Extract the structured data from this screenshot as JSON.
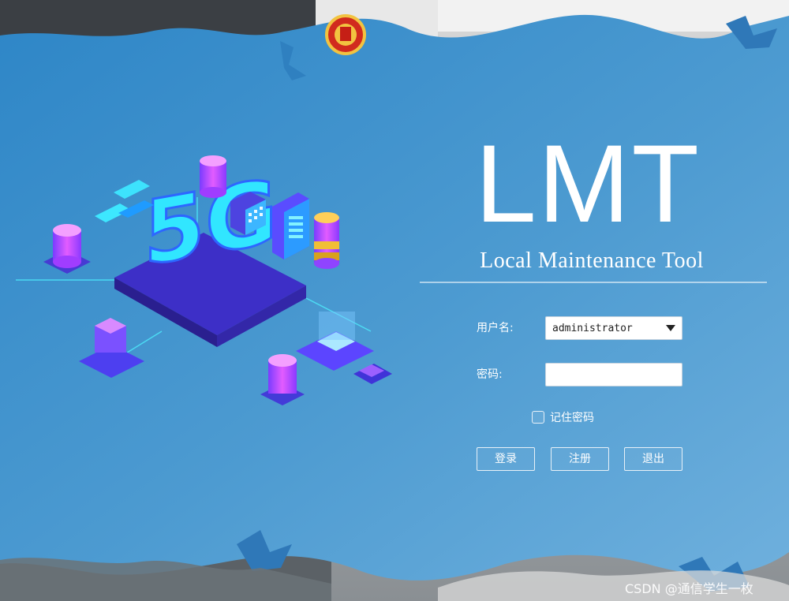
{
  "app": {
    "title": "LMT",
    "subtitle": "Local Maintenance Tool"
  },
  "illustration": {
    "text": "5G"
  },
  "form": {
    "username_label": "用户名:",
    "username_value": "administrator",
    "password_label": "密码:",
    "password_value": "",
    "remember_label": "记住密码",
    "remember_checked": false
  },
  "buttons": {
    "login": "登录",
    "register": "注册",
    "exit": "退出"
  },
  "watermark": "CSDN @通信学生一枚",
  "colors": {
    "background_blue": "#3f90c9",
    "accent_light": "#8fd0ff",
    "text": "#ffffff"
  }
}
